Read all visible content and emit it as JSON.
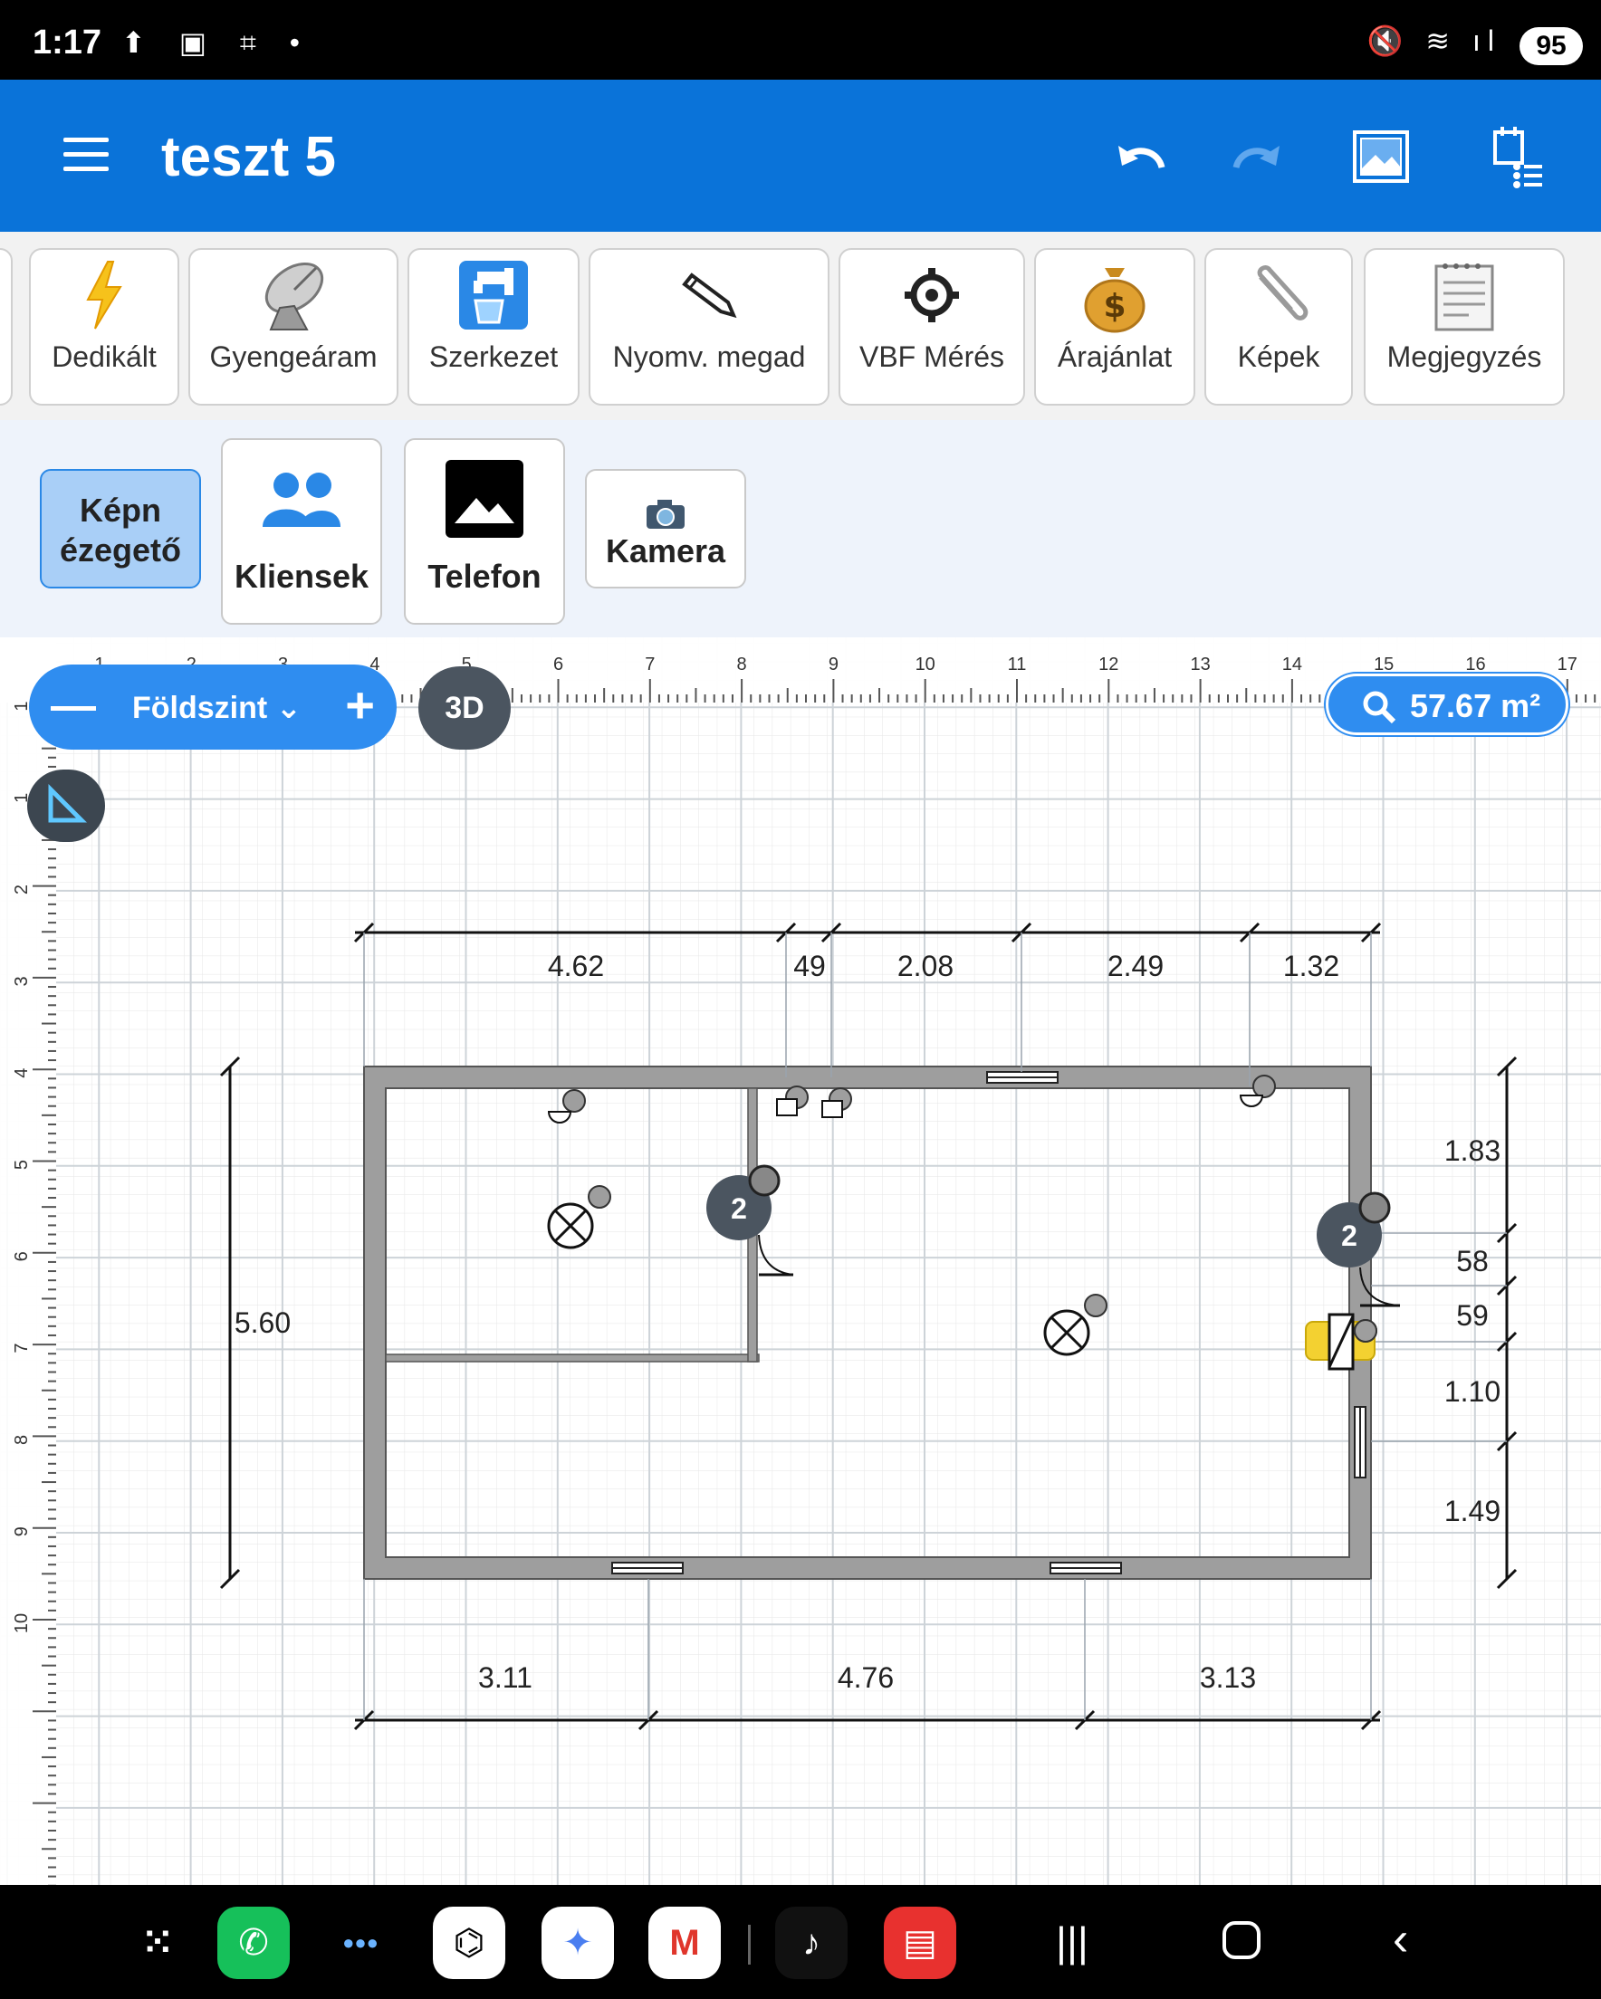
{
  "status_bar": {
    "time": "1:17",
    "battery": "95",
    "left_icons": [
      "upload-icon",
      "screen-record-icon",
      "screenshot-icon",
      "dot-icon"
    ],
    "right_icons": [
      "mute-icon",
      "wifi-icon",
      "signal-icon"
    ]
  },
  "app_bar": {
    "title": "teszt 5",
    "actions": [
      "undo-icon",
      "redo-icon",
      "image-icon",
      "task-list-icon"
    ]
  },
  "toolbar": {
    "items": [
      {
        "label": "Dedikált",
        "icon": "lightning-icon"
      },
      {
        "label": "Gyengeáram",
        "icon": "satellite-dish-icon"
      },
      {
        "label": "Szerkezet",
        "icon": "faucet-icon"
      },
      {
        "label": "Nyomv. megad",
        "icon": "pencil-icon"
      },
      {
        "label": "VBF Mérés",
        "icon": "gear-icon"
      },
      {
        "label": "Árajánlat",
        "icon": "money-bag-icon"
      },
      {
        "label": "Képek",
        "icon": "paperclip-icon"
      },
      {
        "label": "Megjegyzés",
        "icon": "notepad-icon"
      }
    ]
  },
  "row2": {
    "image_viewer": "Képn\nézegető",
    "clients": "Kliensek",
    "phone": "Telefon",
    "camera": "Kamera"
  },
  "floor": {
    "name": "Földszint",
    "view3d": "3D",
    "area": "57.67 m²"
  },
  "ruler": {
    "top_ticks": [
      "1",
      "2",
      "3",
      "4",
      "5",
      "6",
      "7",
      "8",
      "9",
      "10",
      "11",
      "12",
      "13",
      "14",
      "15",
      "16",
      "17"
    ],
    "left_ticks": [
      "1",
      "1",
      "2",
      "3",
      "4",
      "5",
      "6",
      "7",
      "8",
      "9",
      "10"
    ]
  },
  "dimensions": {
    "top": [
      "4.62",
      "49",
      "2.08",
      "2.49",
      "1.32"
    ],
    "bottom": [
      "3.11",
      "4.76",
      "3.13"
    ],
    "left": "5.60",
    "right": [
      "1.83",
      "58",
      "59",
      "1.10",
      "1.49"
    ]
  },
  "markers": {
    "door_count_a": "2",
    "door_count_b": "2"
  },
  "dock_apps": [
    "apps-grid-icon",
    "phone-icon",
    "multi-app-icon",
    "chatgpt-icon",
    "gemini-icon",
    "gmail-icon",
    "tiktok-icon",
    "notes-icon"
  ],
  "nav_buttons": [
    "recents-icon",
    "home-icon",
    "back-icon"
  ],
  "colors": {
    "primary": "#0a73d9",
    "accent": "#2f8df0",
    "wall": "#9e9e9e"
  }
}
